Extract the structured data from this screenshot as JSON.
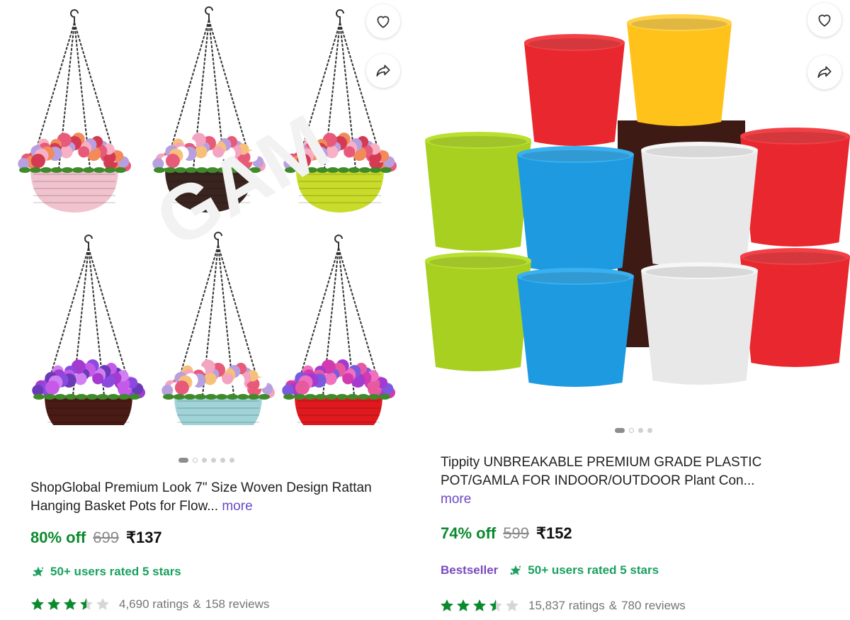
{
  "products": [
    {
      "title": "ShopGlobal Premium Look 7\" Size Woven Design Rattan Hanging Basket Pots for Flow...",
      "more": "more",
      "discount": "80% off",
      "mrp": "699",
      "price": "₹137",
      "badge": "",
      "rated": "50+ users rated 5 stars",
      "rating_value": 3.5,
      "ratings": "4,690 ratings",
      "amp": "&",
      "reviews": "158 reviews",
      "carousel_pages": 6,
      "carousel_active": 1,
      "watermark": "GAM"
    },
    {
      "title": "Tippity UNBREAKABLE PREMIUM GRADE PLASTIC POT/GAMLA FOR INDOOR/OUTDOOR Plant Con...",
      "more": "more",
      "discount": "74% off",
      "mrp": "599",
      "price": "₹152",
      "badge": "Bestseller",
      "rated": "50+ users rated 5 stars",
      "rating_value": 3.5,
      "ratings": "15,837 ratings",
      "amp": "&",
      "reviews": "780 reviews",
      "carousel_pages": 4,
      "carousel_active": 1
    }
  ],
  "icons": {
    "wishlist": "heart-icon",
    "share": "share-icon",
    "rated_badge": "star-badge-icon",
    "rating_star": "star-icon"
  },
  "colors": {
    "discount": "#0a8a2e",
    "rated": "#1aa060",
    "bestseller": "#7a49bf",
    "more_link": "#6a49c7",
    "stars": "#0a8a2e"
  }
}
